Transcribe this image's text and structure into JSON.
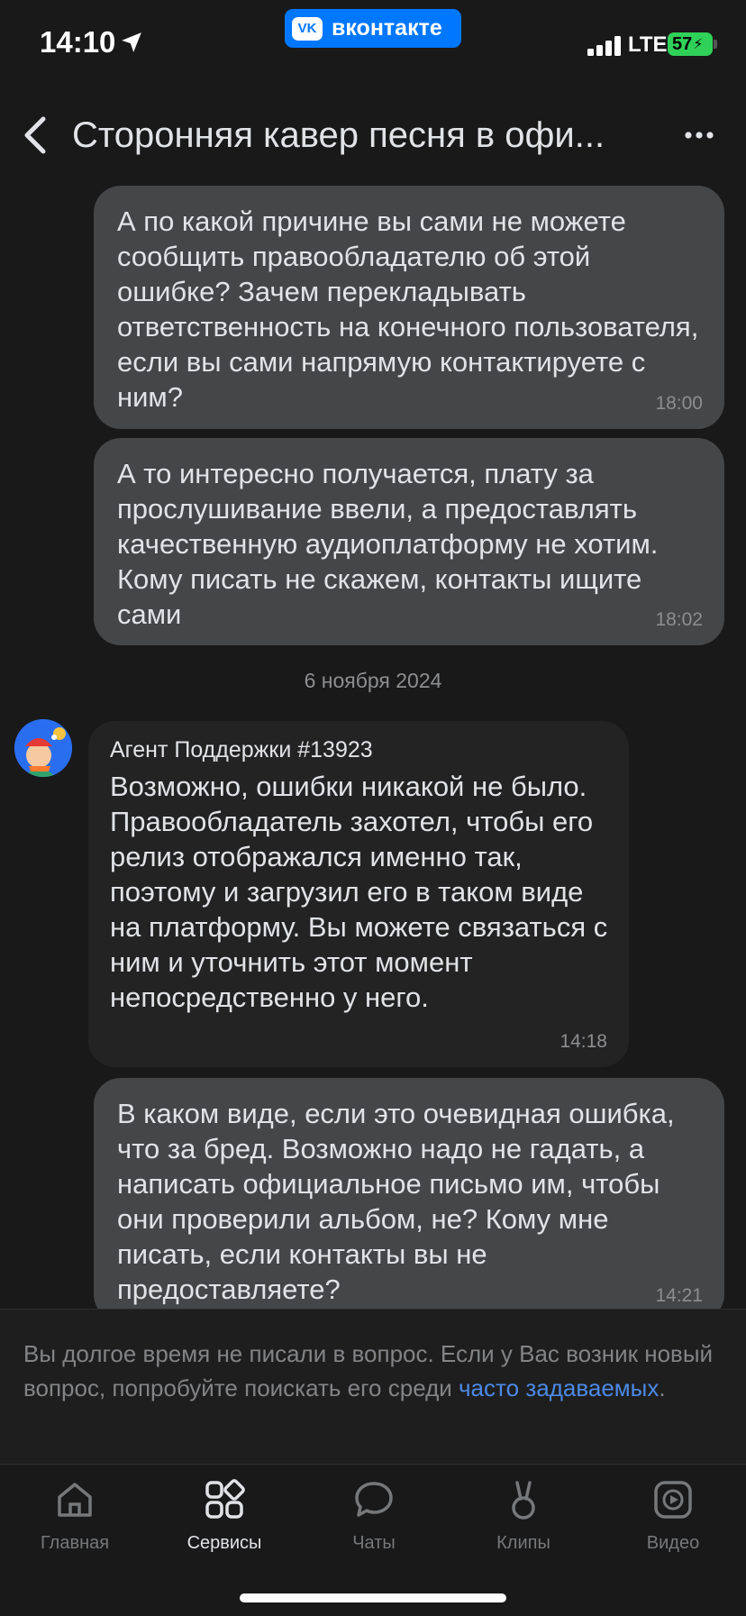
{
  "status_bar": {
    "time": "14:10",
    "app_badge": "вконтакте",
    "vk_logo": "VK",
    "network": "LTE",
    "battery": "57"
  },
  "header": {
    "title": "Сторонняя кавер песня в офи..."
  },
  "messages": [
    {
      "text": "А по какой причине вы сами не можете сообщить правообладателю об этой ошибке? Зачем перекладывать ответственность на конечного пользователя, если вы сами напрямую контактируете с ним?",
      "time": "18:00"
    },
    {
      "text": "А то интересно получается, плату за прослушивание ввели, а предоставлять качественную аудиоплатформу не хотим. Кому писать не скажем, контакты ищите сами",
      "time": "18:02"
    },
    {
      "author": "Агент Поддержки #13923",
      "text": "Возможно, ошибки никакой не было. Правообладатель захотел, чтобы его релиз отображался именно так, поэтому и загрузил его в таком виде на платформу. Вы можете связаться с ним и уточнить этот момент непосредственно у него.",
      "time": "14:18"
    },
    {
      "text": "В каком виде, если это очевидная ошибка, что за бред. Возможно надо не гадать, а написать официальное письмо им, чтобы они проверили альбом, не? Кому мне писать, если контакты вы не предоставляете?",
      "time": "14:21"
    }
  ],
  "date_separator": "6 ноября 2024",
  "notice": {
    "text": "Вы долгое время не писали в вопрос. Если у Вас возник новый вопрос, попробуйте поискать его среди ",
    "link": "часто задаваемых",
    "suffix": "."
  },
  "tabs": [
    {
      "label": "Главная",
      "icon": "home-icon"
    },
    {
      "label": "Сервисы",
      "icon": "services-icon",
      "active": true
    },
    {
      "label": "Чаты",
      "icon": "chat-icon"
    },
    {
      "label": "Клипы",
      "icon": "clips-icon"
    },
    {
      "label": "Видео",
      "icon": "video-icon"
    }
  ],
  "colors": {
    "background": "#19191a",
    "bubble_outgoing": "#454647",
    "bubble_incoming": "#232324",
    "accent": "#0077ff",
    "link": "#4c8ae6"
  }
}
